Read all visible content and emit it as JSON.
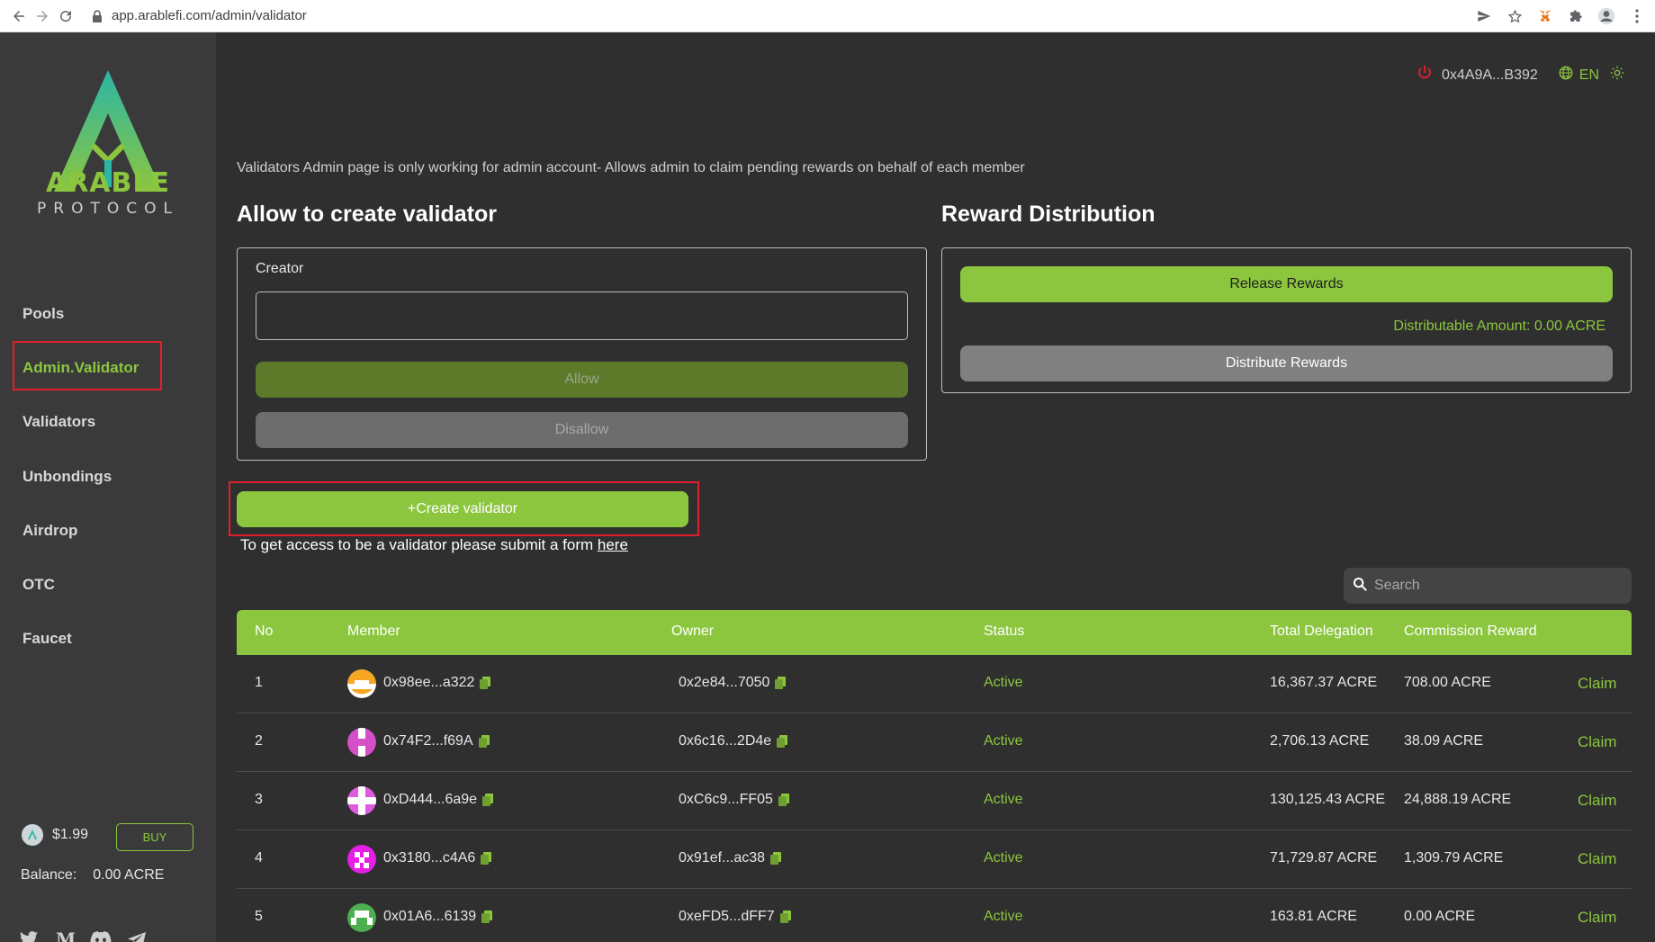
{
  "browser": {
    "url": "app.arablefi.com/admin/validator"
  },
  "sidebar": {
    "logo_text": "PROTOCOL",
    "logo_brand": "ARABLE",
    "items": [
      {
        "label": "Pools"
      },
      {
        "label": "Admin.Validator",
        "active": true
      },
      {
        "label": "Validators"
      },
      {
        "label": "Unbondings"
      },
      {
        "label": "Airdrop"
      },
      {
        "label": "OTC"
      },
      {
        "label": "Faucet"
      }
    ],
    "price": "$1.99",
    "buy_label": "BUY",
    "balance_label": "Balance:",
    "balance_value": "0.00 ACRE"
  },
  "header": {
    "wallet": "0x4A9A...B392",
    "language": "EN"
  },
  "notice": "Validators Admin page is only working for admin account- Allows admin to claim pending rewards on behalf of each member",
  "allow_section": {
    "title": "Allow to create validator",
    "creator_label": "Creator",
    "creator_value": "",
    "allow_label": "Allow",
    "disallow_label": "Disallow"
  },
  "reward_section": {
    "title": "Reward Distribution",
    "release_label": "Release Rewards",
    "distributable": "Distributable Amount: 0.00 ACRE",
    "distribute_label": "Distribute Rewards"
  },
  "create": {
    "label": "+Create validator",
    "note": "To get access to be a validator please submit a form",
    "link": "here"
  },
  "search": {
    "placeholder": "Search"
  },
  "table": {
    "headers": [
      "No",
      "Member",
      "Owner",
      "Status",
      "Total Delegation",
      "Commission Reward"
    ],
    "rows": [
      {
        "no": "1",
        "member": "0x98ee...a322",
        "owner": "0x2e84...7050",
        "status": "Active",
        "delegation": "16,367.37 ACRE",
        "commission": "708.00 ACRE",
        "action": "Claim",
        "avatar_color": "#f5a623"
      },
      {
        "no": "2",
        "member": "0x74F2...f69A",
        "owner": "0x6c16...2D4e",
        "status": "Active",
        "delegation": "2,706.13 ACRE",
        "commission": "38.09 ACRE",
        "action": "Claim",
        "avatar_color": "#d44fc8"
      },
      {
        "no": "3",
        "member": "0xD444...6a9e",
        "owner": "0xC6c9...FF05",
        "status": "Active",
        "delegation": "130,125.43 ACRE",
        "commission": "24,888.19 ACRE",
        "action": "Claim",
        "avatar_color": "#e05ae0"
      },
      {
        "no": "4",
        "member": "0x3180...c4A6",
        "owner": "0x91ef...ac38",
        "status": "Active",
        "delegation": "71,729.87 ACRE",
        "commission": "1,309.79 ACRE",
        "action": "Claim",
        "avatar_color": "#e61ee6"
      },
      {
        "no": "5",
        "member": "0x01A6...6139",
        "owner": "0xeFD5...dFF7",
        "status": "Active",
        "delegation": "163.81 ACRE",
        "commission": "0.00 ACRE",
        "action": "Claim",
        "avatar_color": "#4caf50"
      }
    ]
  },
  "colors": {
    "accent": "#8cc63f",
    "highlight_box": "#e0202e",
    "sidebar_bg": "#3a3a3a",
    "main_bg": "#2f2f2f"
  }
}
